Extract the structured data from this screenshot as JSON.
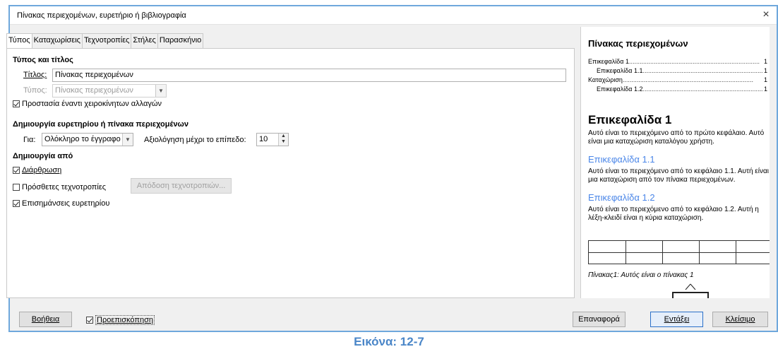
{
  "dialog": {
    "title": "Πίνακας περιεχομένων, ευρετήριο ή βιβλιογραφία",
    "close_glyph": "×"
  },
  "tabs": [
    {
      "label": "Τύπος",
      "active": true
    },
    {
      "label": "Καταχωρίσεις",
      "active": false
    },
    {
      "label": "Τεχνοτροπίες",
      "active": false
    },
    {
      "label": "Στήλες",
      "active": false
    },
    {
      "label": "Παρασκήνιο",
      "active": false
    }
  ],
  "type_section": {
    "heading": "Τύπος και τίτλος",
    "title_label": "Τίτλος:",
    "title_value": "Πίνακας περιεχομένων",
    "type_label": "Τύπος:",
    "type_value": "Πίνακας περιεχομένων",
    "protect_label": "Προστασία έναντι χειροκίνητων αλλαγών",
    "protect_checked": true
  },
  "create_index_section": {
    "heading": "Δημιουργία ευρετηρίου ή πίνακα περιεχομένων",
    "for_label": "Για:",
    "for_value": "Ολόκληρο το έγγραφο",
    "level_label": "Αξιολόγηση μέχρι το επίπεδο:",
    "level_value": "10"
  },
  "create_from_section": {
    "heading": "Δημιουργία από",
    "outline_label": "Διάρθρωση",
    "outline_checked": true,
    "extra_styles_label": "Πρόσθετες τεχνοτροπίες",
    "extra_styles_checked": false,
    "assign_styles_button": "Απόδοση τεχνοτροπιών...",
    "index_marks_label": "Επισημάνσεις ευρετηρίου",
    "index_marks_checked": true
  },
  "preview": {
    "toc_title": "Πίνακας περιεχομένων",
    "toc_entries": [
      {
        "text": "Επικεφαλίδα 1",
        "page": "1",
        "indent": false
      },
      {
        "text": "Επικεφαλίδα 1.1",
        "page": "1",
        "indent": true
      },
      {
        "text": "Καταχώριση",
        "page": "1",
        "indent": false
      },
      {
        "text": "Επικεφαλίδα 1.2",
        "page": "1",
        "indent": true
      }
    ],
    "heading1": "Επικεφαλίδα 1",
    "para1": "Αυτό είναι το περιεχόμενο από το πρώτο κεφάλαιο. Αυτό είναι μια καταχώριση καταλόγου χρήστη.",
    "heading11": "Επικεφαλίδα 1.1",
    "para11": "Αυτό είναι το περιεχόμενο από το κεφάλαιο 1.1. Αυτή είναι μια καταχώριση από τον πίνακα περιεχομένων.",
    "heading12": "Επικεφαλίδα 1.2",
    "para12": "Αυτό είναι το περιεχόμενο από το κεφάλαιο 1.2. Αυτή η λέξη-κλειδί είναι η κύρια καταχώριση.",
    "table_caption": "Πίνακας1: Αυτός είναι ο πίνακας 1",
    "heading_color": "#4a86e8"
  },
  "footer": {
    "help_button": "Βοήθεια",
    "preview_label": "Προεπισκόπηση",
    "preview_checked": true,
    "reset_button": "Επαναφορά",
    "insert_button": "Εντάξει",
    "close_button": "Κλείσιμο"
  },
  "figure_caption": "Εικόνα: 12-7",
  "colors": {
    "frame": "#6fa8dc",
    "caption": "#4a86c8"
  }
}
